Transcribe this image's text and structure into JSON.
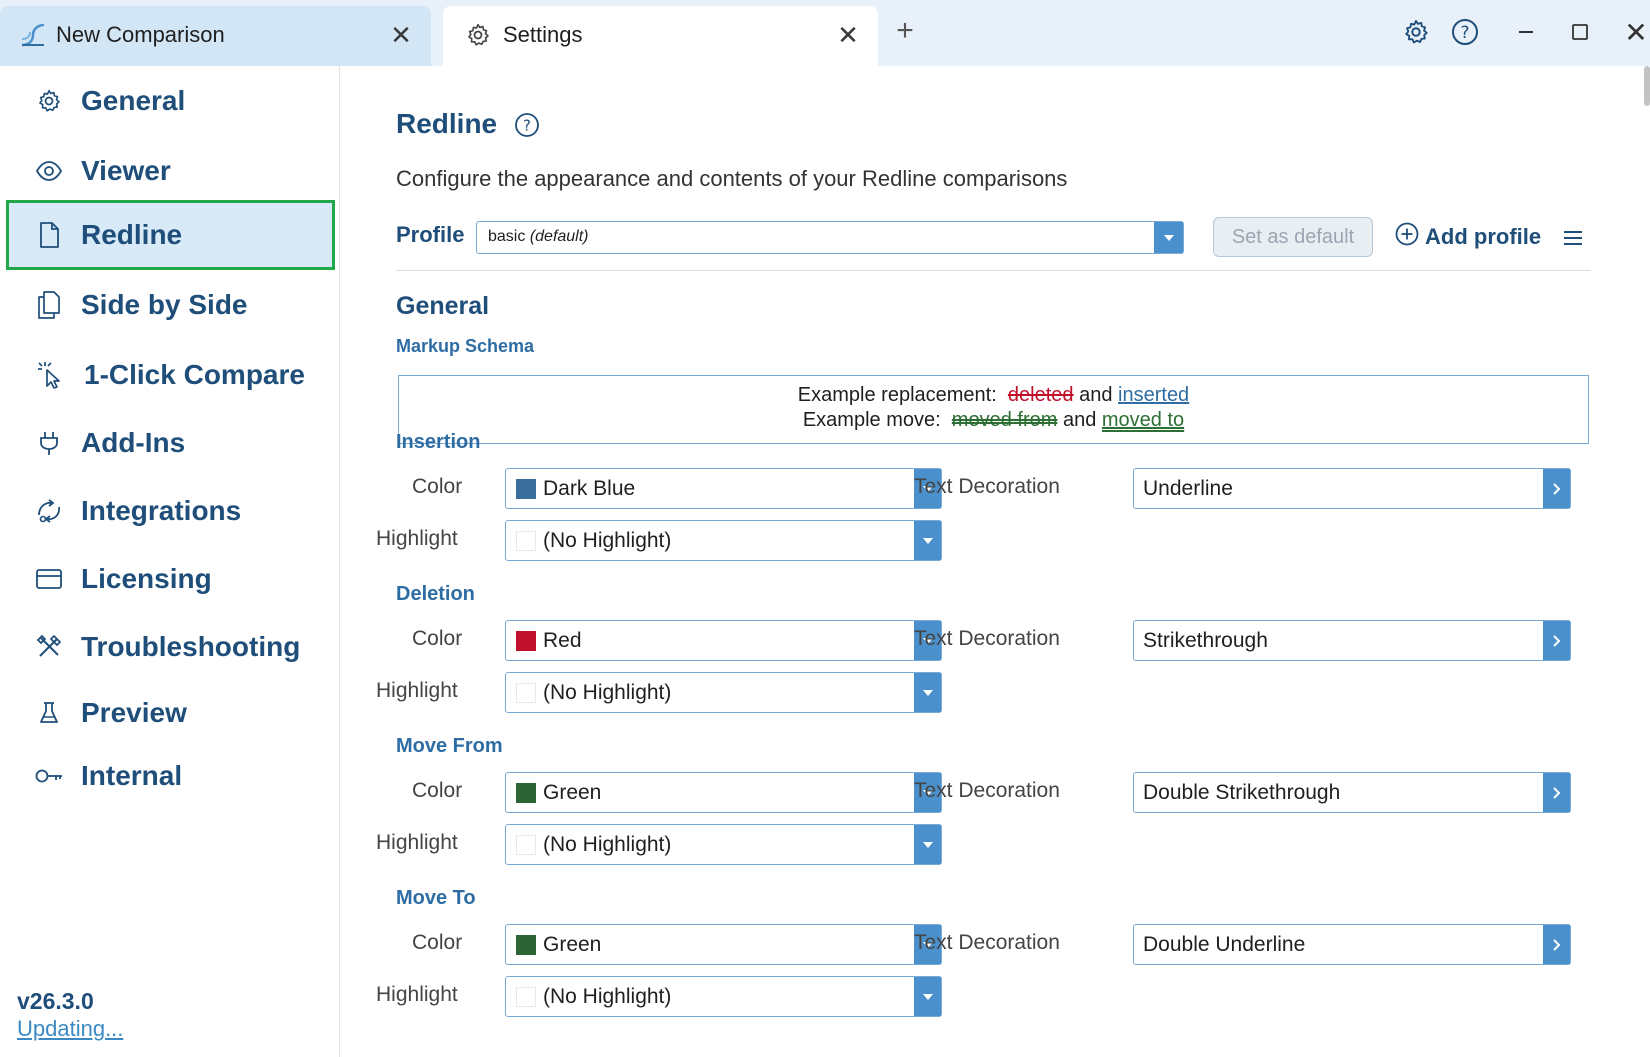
{
  "tabs": [
    {
      "label": "New Comparison",
      "icon": "compare-logo-icon"
    },
    {
      "label": "Settings",
      "icon": "gear-icon"
    }
  ],
  "sidebar": {
    "items": [
      {
        "label": "General",
        "icon": "gear-icon"
      },
      {
        "label": "Viewer",
        "icon": "eye-icon"
      },
      {
        "label": "Redline",
        "icon": "document-icon",
        "active": true
      },
      {
        "label": "Side by Side",
        "icon": "documents-icon"
      },
      {
        "label": "1-Click Compare",
        "icon": "click-cursor-icon"
      },
      {
        "label": "Add-Ins",
        "icon": "plug-icon"
      },
      {
        "label": "Integrations",
        "icon": "integrations-icon"
      },
      {
        "label": "Licensing",
        "icon": "card-icon"
      },
      {
        "label": "Troubleshooting",
        "icon": "tools-icon"
      },
      {
        "label": "Preview",
        "icon": "flask-icon"
      },
      {
        "label": "Internal",
        "icon": "key-icon"
      }
    ],
    "version": "v26.3.0",
    "update_status": "Updating..."
  },
  "main": {
    "title": "Redline",
    "description": "Configure the appearance and contents of your Redline comparisons",
    "profile": {
      "label": "Profile",
      "value": "basic",
      "value_suffix": "(default)",
      "set_default_label": "Set as default",
      "add_profile_label": "Add profile"
    },
    "section_title": "General",
    "markup_schema": {
      "title": "Markup Schema",
      "replacement_prefix": "Example replacement:",
      "deleted": "deleted",
      "and1": "and",
      "inserted": "inserted",
      "move_prefix": "Example move:",
      "moved_from": "moved from",
      "and2": "and",
      "moved_to": "moved to"
    },
    "color_label": "Color",
    "highlight_label": "Highlight",
    "decoration_label": "Text Decoration",
    "groups": [
      {
        "title": "Insertion",
        "color": "Dark Blue",
        "swatch": "#3a6e9c",
        "highlight": "(No Highlight)",
        "decoration": "Underline"
      },
      {
        "title": "Deletion",
        "color": "Red",
        "swatch": "#c0102b",
        "highlight": "(No Highlight)",
        "decoration": "Strikethrough"
      },
      {
        "title": "Move From",
        "color": "Green",
        "swatch": "#2d6436",
        "highlight": "(No Highlight)",
        "decoration": "Double Strikethrough"
      },
      {
        "title": "Move To",
        "color": "Green",
        "swatch": "#2d6436",
        "highlight": "(No Highlight)",
        "decoration": "Double Underline"
      }
    ]
  },
  "colors": {
    "accent": "#1e4e79",
    "link": "#3b8ac4",
    "dropdown": "#4a90cd",
    "active_border": "#22a84b"
  }
}
